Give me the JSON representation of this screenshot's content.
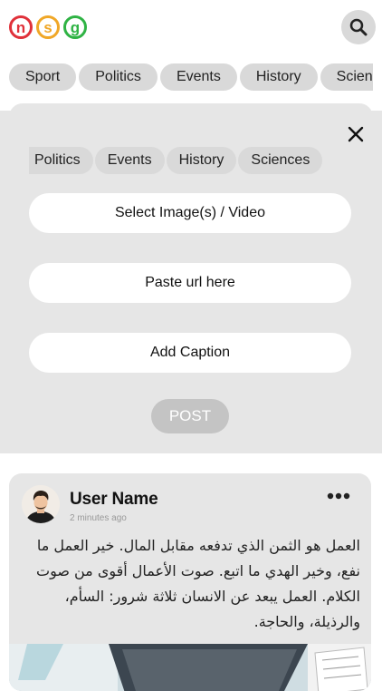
{
  "header": {
    "logo_letters": [
      "n",
      "s",
      "g"
    ],
    "logo_colors": [
      "#e0313a",
      "#f0a727",
      "#2fb344"
    ],
    "search_icon": "search-icon"
  },
  "categories": [
    "Sport",
    "Politics",
    "Events",
    "History",
    "Sciences"
  ],
  "composer": {
    "close_icon": "close-icon",
    "categories": [
      "Politics",
      "Events",
      "History",
      "Sciences"
    ],
    "select_media_label": "Select Image(s) / Video",
    "url_placeholder": "Paste url here",
    "caption_placeholder": "Add Caption",
    "post_label": "POST"
  },
  "post": {
    "user_name": "User Name",
    "time": "2 minutes ago",
    "more_icon": "more-icon",
    "text": "العمل هو الثمن الذي تدفعه مقابل المال. خير العمل ما نفع، وخير الهدي ما اتبع. صوت الأعمال أقوى من صوت الكلام. العمل يبعد عن الانسان ثلاثة شرور: السأم، والرذيلة، والحاجة."
  }
}
